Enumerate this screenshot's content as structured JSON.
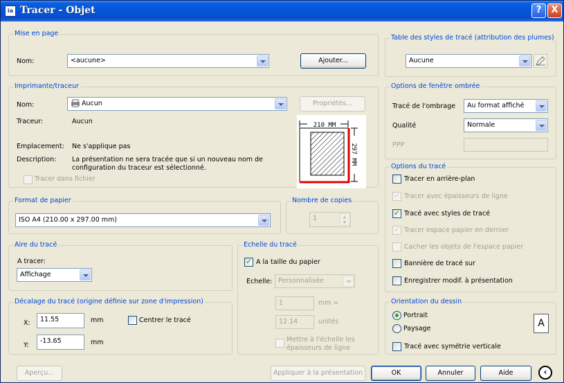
{
  "window": {
    "title": "Tracer - Objet",
    "app_icon": "autocad-plot-icon",
    "help": "?",
    "close": "X"
  },
  "page_setup": {
    "legend": "Mise en page",
    "name_label": "Nom:",
    "name_value": "<aucune>",
    "add_button": "Ajouter..."
  },
  "plotter": {
    "legend": "Imprimante/traceur",
    "name_label": "Nom:",
    "name_value": "Aucun",
    "properties_button": "Propriétés...",
    "plotter_label": "Traceur:",
    "plotter_value": "Aucun",
    "location_label": "Emplacement:",
    "location_value": "Ne s'applique pas",
    "description_label": "Description:",
    "description_line1": "La présentation ne sera tracée que si un nouveau nom de",
    "description_line2": "configuration du traceur est sélectionné.",
    "plot_to_file": "Tracer dans fichier",
    "preview_width": "210 MM",
    "preview_height": "297 MM"
  },
  "paper_size": {
    "legend": "Format de papier",
    "value": "ISO A4 (210.00 x 297.00 mm)"
  },
  "copies": {
    "legend": "Nombre de copies",
    "value": "1"
  },
  "plot_area": {
    "legend": "Aire du tracé",
    "what_label": "A tracer:",
    "value": "Affichage"
  },
  "plot_offset": {
    "legend": "Décalage du tracé (origine définie sur zone d'impression)",
    "x_label": "X:",
    "x_value": "11.55",
    "x_unit": "mm",
    "y_label": "Y:",
    "y_value": "-13.65",
    "y_unit": "mm",
    "center": "Centrer le tracé"
  },
  "plot_scale": {
    "legend": "Echelle du tracé",
    "fit_paper": "A la taille du papier",
    "scale_label": "Echelle:",
    "scale_value": "Personnalisée",
    "value1": "1",
    "unit1": "mm =",
    "value2": "12.14",
    "unit2": "unités",
    "scale_lineweights_1": "Mettre à l'échelle les",
    "scale_lineweights_2": "épaisseurs de ligne"
  },
  "plot_style_table": {
    "legend": "Table des styles de tracé (attribution des plumes)",
    "value": "Aucune"
  },
  "shaded_viewport": {
    "legend": "Options de fenêtre ombrée",
    "shade_label": "Tracé de l'ombrage",
    "shade_value": "Au format affiché",
    "quality_label": "Qualité",
    "quality_value": "Normale",
    "dpi_label": "PPP",
    "dpi_value": ""
  },
  "plot_options": {
    "legend": "Options du tracé",
    "items": [
      {
        "label": "Tracer en arrière-plan",
        "checked": false,
        "enabled": true
      },
      {
        "label": "Tracer avec épaisseurs de ligne",
        "checked": true,
        "enabled": false
      },
      {
        "label": "Tracé avec styles de tracé",
        "checked": true,
        "enabled": true
      },
      {
        "label": "Tracer espace papier en dernier",
        "checked": true,
        "enabled": false
      },
      {
        "label": "Cacher les objets de l'espace papier",
        "checked": false,
        "enabled": false
      },
      {
        "label": "Bannière de tracé sur",
        "checked": false,
        "enabled": true
      },
      {
        "label": "Enregistrer modif. à présentation",
        "checked": false,
        "enabled": true
      }
    ]
  },
  "orientation": {
    "legend": "Orientation du dessin",
    "portrait": "Portrait",
    "landscape": "Paysage",
    "selected": "portrait",
    "upside_down": "Tracé avec symétrie verticale",
    "icon_letter": "A"
  },
  "footer": {
    "preview": "Aperçu...",
    "apply": "Appliquer à la présentation",
    "ok": "OK",
    "cancel": "Annuler",
    "help": "Aide"
  },
  "colors": {
    "accent": "#0046d5",
    "title_bar": "#0453d8",
    "paper_red": "#e00000"
  }
}
